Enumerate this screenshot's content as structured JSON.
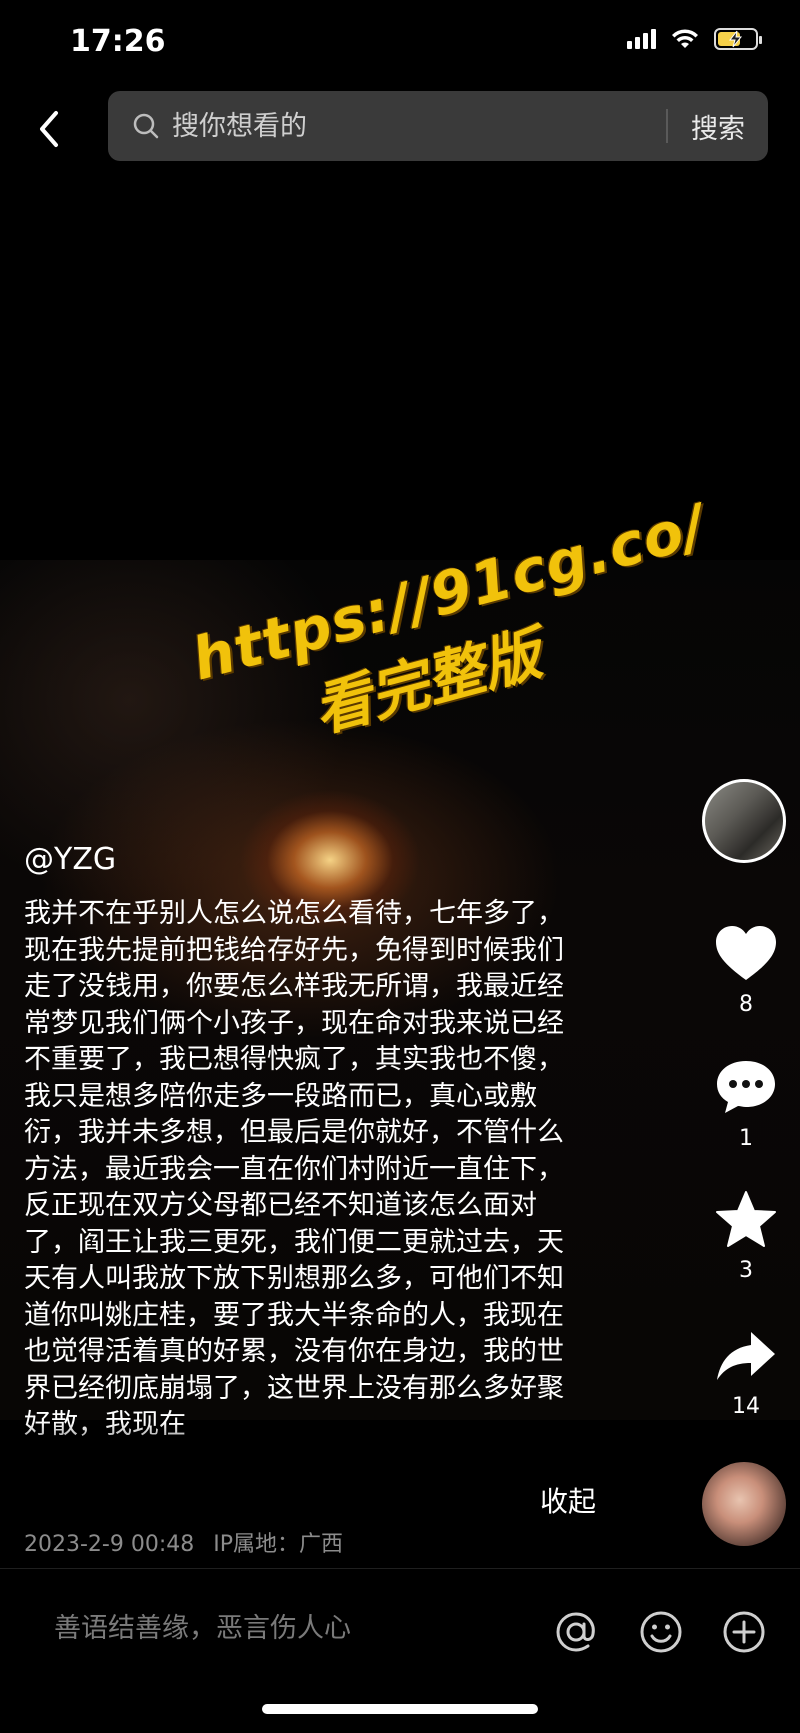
{
  "status_bar": {
    "time": "17:26"
  },
  "header": {
    "search_placeholder": "搜你想看的",
    "search_button": "搜索"
  },
  "watermark": {
    "url": "https://91cg.co/",
    "line2": "看完整版"
  },
  "post": {
    "author": "@YZG",
    "description": "我并不在乎别人怎么说怎么看待，七年多了，现在我先提前把钱给存好先，免得到时候我们走了没钱用，你要怎么样我无所谓，我最近经常梦见我们俩个小孩子，现在命对我来说已经不重要了，我已想得快疯了，其实我也不傻，我只是想多陪你走多一段路而已，真心或敷衍，我并未多想，但最后是你就好，不管什么方法，最近我会一直在你们村附近一直住下，反正现在双方父母都已经不知道该怎么面对了，阎王让我三更死，我们便二更就过去，天天有人叫我放下放下别想那么多，可他们不知道你叫姚庄桂，要了我大半条命的人，我现在也觉得活着真的好累，没有你在身边，我的世界已经彻底崩塌了，这世界上没有那么多好聚好散，我现在",
    "collapse_label": "收起",
    "date": "2023-2-9 00:48",
    "ip_location": "IP属地：广西"
  },
  "actions": {
    "like_count": "8",
    "comment_count": "1",
    "favorite_count": "3",
    "share_count": "14"
  },
  "comment_bar": {
    "placeholder": "善语结善缘，恶言伤人心"
  }
}
